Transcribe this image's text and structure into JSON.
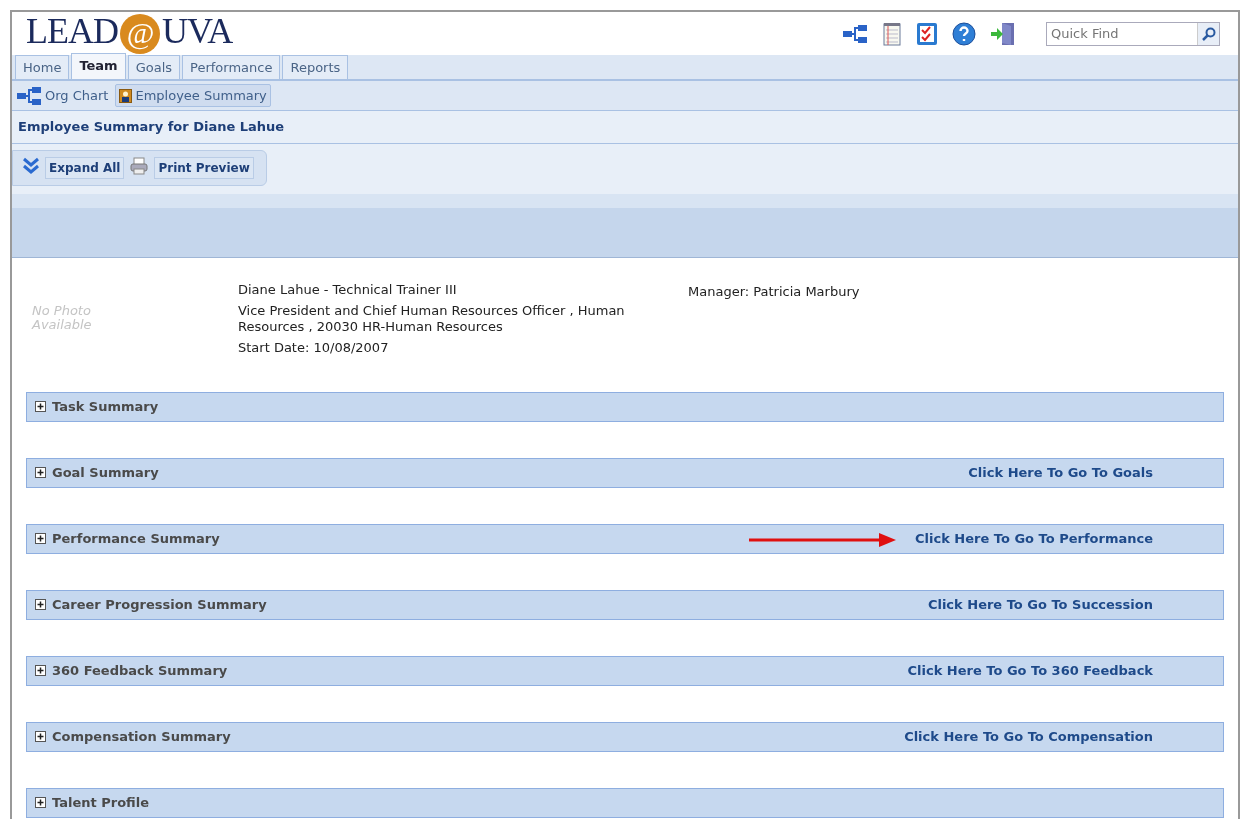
{
  "logo": {
    "left": "LEAD",
    "at": "@",
    "right": "UVA"
  },
  "search": {
    "placeholder": "Quick Find"
  },
  "tabs": [
    {
      "label": "Home",
      "selected": false
    },
    {
      "label": "Team",
      "selected": true
    },
    {
      "label": "Goals",
      "selected": false
    },
    {
      "label": "Performance",
      "selected": false
    },
    {
      "label": "Reports",
      "selected": false
    }
  ],
  "subnav": [
    {
      "label": "Org Chart",
      "selected": false
    },
    {
      "label": "Employee Summary",
      "selected": true
    }
  ],
  "page_title": "Employee Summary for Diane Lahue",
  "toolbar": [
    {
      "label": "Expand All"
    },
    {
      "label": "Print Preview"
    }
  ],
  "employee": {
    "photo_placeholder": "No Photo\nAvailable",
    "name_title": "Diane Lahue - Technical Trainer III",
    "department": "Vice President and Chief Human Resources Officer ,  Human Resources ,  20030 HR-Human Resources",
    "start_date": "Start Date: 10/08/2007",
    "manager": "Manager: Patricia Marbury"
  },
  "sections": [
    {
      "title": "Task Summary",
      "expanded": false
    },
    {
      "title": "Goal Summary",
      "expanded": false,
      "link": "Click Here To Go To Goals"
    },
    {
      "title": "Performance Summary",
      "expanded": false,
      "link": "Click Here To Go To Performance",
      "annotation_arrow": true
    },
    {
      "title": "Career Progression Summary",
      "expanded": false,
      "link": "Click Here To Go To Succession"
    },
    {
      "title": "360 Feedback Summary",
      "expanded": false,
      "link": "Click Here To Go To 360 Feedback"
    },
    {
      "title": "Compensation Summary",
      "expanded": false,
      "link": "Click Here To Go To Compensation"
    },
    {
      "title": "Talent Profile",
      "expanded": false
    }
  ]
}
